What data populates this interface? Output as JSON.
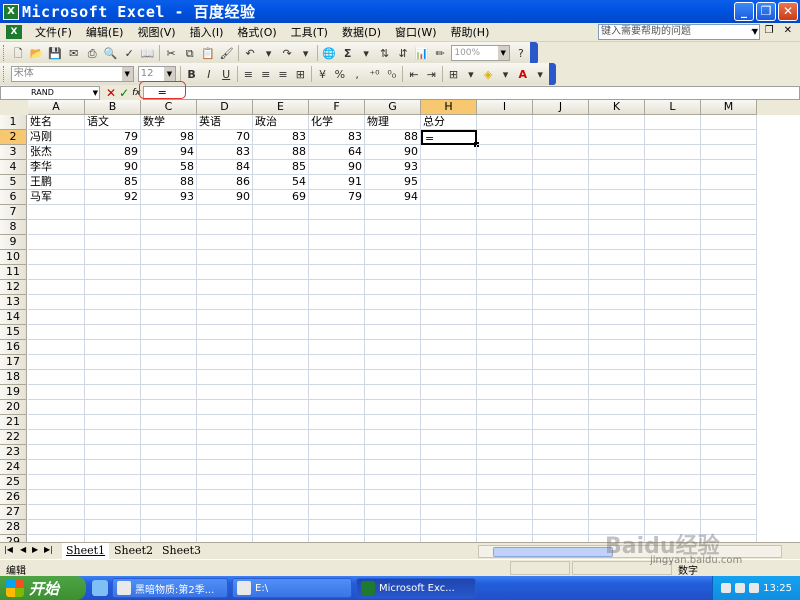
{
  "window": {
    "title": "Microsoft Excel - 百度经验",
    "app_icon": "excel-icon"
  },
  "menu": {
    "items": [
      "文件(F)",
      "编辑(E)",
      "视图(V)",
      "插入(I)",
      "格式(O)",
      "工具(T)",
      "数据(D)",
      "窗口(W)",
      "帮助(H)"
    ],
    "help_placeholder": "键入需要帮助的问题"
  },
  "toolbar": {
    "zoom": "100%",
    "font_name": "宋体",
    "font_size": "12"
  },
  "formula_bar": {
    "name_box": "RAND",
    "formula": "="
  },
  "sheet": {
    "columns": [
      "A",
      "B",
      "C",
      "D",
      "E",
      "F",
      "G",
      "H",
      "I",
      "J",
      "K",
      "L",
      "M"
    ],
    "active_column": "H",
    "active_row": 2,
    "row_count": 29,
    "rows": [
      [
        "姓名",
        "语文",
        "数学",
        "英语",
        "政治",
        "化学",
        "物理",
        "总分"
      ],
      [
        "冯刚",
        "79",
        "98",
        "70",
        "83",
        "83",
        "88",
        "="
      ],
      [
        "张杰",
        "89",
        "94",
        "83",
        "88",
        "64",
        "90",
        ""
      ],
      [
        "李华",
        "90",
        "58",
        "84",
        "85",
        "90",
        "93",
        ""
      ],
      [
        "王鹏",
        "85",
        "88",
        "86",
        "54",
        "91",
        "95",
        ""
      ],
      [
        "马军",
        "92",
        "93",
        "90",
        "69",
        "79",
        "94",
        ""
      ]
    ]
  },
  "tabs": [
    "Sheet1",
    "Sheet2",
    "Sheet3"
  ],
  "active_tab": "Sheet1",
  "status": {
    "mode": "编辑",
    "num": "数字"
  },
  "taskbar": {
    "start": "开始",
    "tasks": [
      "黑暗物质:第2季...",
      "E:\\",
      "Microsoft Exc..."
    ],
    "active_task": "Microsoft Exc...",
    "clock": "13:25"
  },
  "watermark": {
    "logo": "Baidu经验",
    "url": "jingyan.baidu.com"
  }
}
